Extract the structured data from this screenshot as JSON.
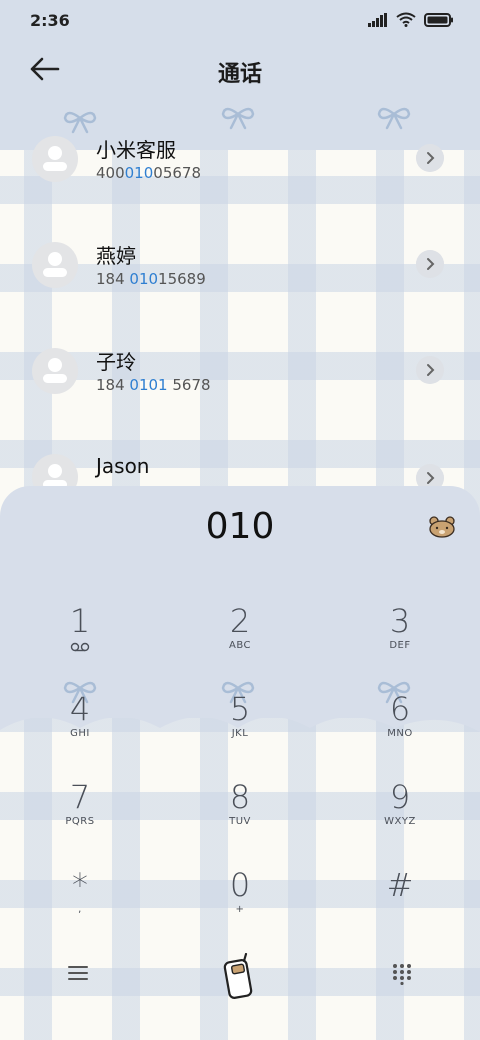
{
  "status_bar": {
    "time": "2:36"
  },
  "header": {
    "title": "通话"
  },
  "contacts": [
    {
      "name": "小米客服",
      "number_parts": [
        "400",
        "010",
        "05678"
      ]
    },
    {
      "name": "燕婷",
      "number_parts": [
        "184 ",
        "010",
        "15689"
      ]
    },
    {
      "name": "子玲",
      "number_parts": [
        "184 ",
        "0101",
        " 5678"
      ]
    },
    {
      "name": "Jason",
      "number_parts": [
        "",
        "",
        ""
      ]
    }
  ],
  "dialer": {
    "display": "010",
    "keys": [
      {
        "digit": "1",
        "letters": "ꝏ"
      },
      {
        "digit": "2",
        "letters": "ABC"
      },
      {
        "digit": "3",
        "letters": "DEF"
      },
      {
        "digit": "4",
        "letters": "GHI"
      },
      {
        "digit": "5",
        "letters": "JKL"
      },
      {
        "digit": "6",
        "letters": "MNO"
      },
      {
        "digit": "7",
        "letters": "PQRS"
      },
      {
        "digit": "8",
        "letters": "TUV"
      },
      {
        "digit": "9",
        "letters": "WXYZ"
      },
      {
        "digit": "*",
        "letters": ","
      },
      {
        "digit": "0",
        "letters": "+"
      },
      {
        "digit": "#",
        "letters": ""
      }
    ]
  },
  "icons": {
    "back": "arrow-left-icon",
    "menu": "menu-icon",
    "call": "phone-call-icon",
    "keypad": "keypad-icon",
    "bear": "bear-icon"
  },
  "colors": {
    "banner": "#d6deea",
    "highlight": "#2f7fd1",
    "key_text": "#4a4f58"
  }
}
